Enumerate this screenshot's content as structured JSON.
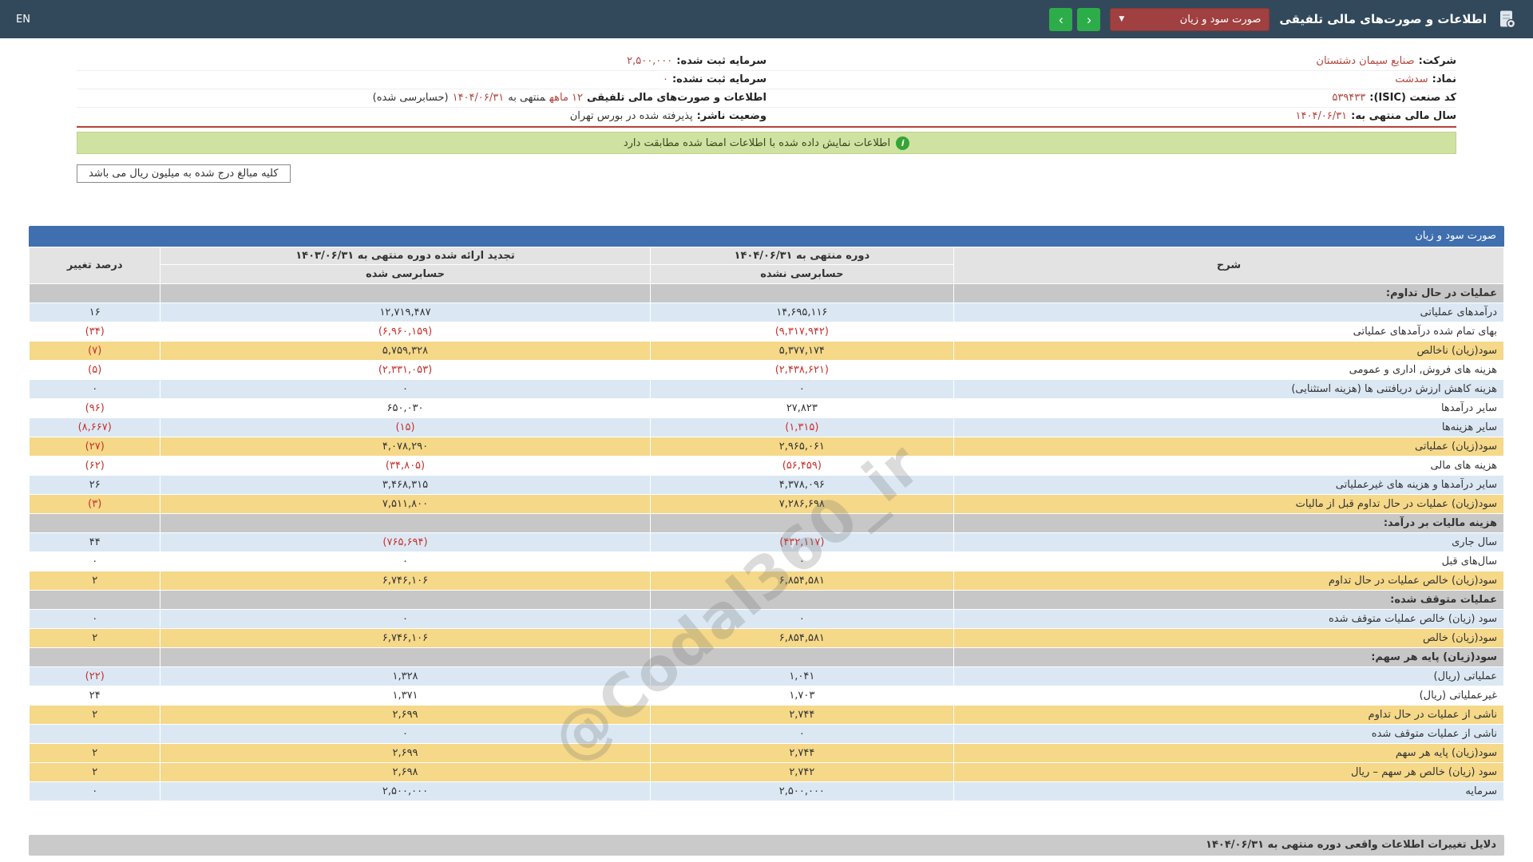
{
  "navbar": {
    "lang": "EN",
    "title": "اطلاعات و صورت‌های مالی تلفیقی",
    "dropdown": "صورت سود و زیان"
  },
  "icons": {
    "chevron_down": "▼",
    "prev": "‹",
    "next": "›",
    "info": "i"
  },
  "info": {
    "right": [
      {
        "parts": [
          {
            "t": "شرکت:",
            "s": "label"
          },
          {
            "t": "صنایع سیمان دشتستان",
            "s": "red"
          }
        ]
      },
      {
        "parts": [
          {
            "t": "نماد:",
            "s": "label"
          },
          {
            "t": "سدشت",
            "s": "red"
          }
        ]
      },
      {
        "parts": [
          {
            "t": "کد صنعت (ISIC):",
            "s": "label"
          },
          {
            "t": "۵۳۹۴۳۳",
            "s": "red"
          }
        ]
      },
      {
        "parts": [
          {
            "t": "سال مالی منتهی به:",
            "s": "label"
          },
          {
            "t": "۱۴۰۴/۰۶/۳۱",
            "s": "red"
          }
        ]
      }
    ],
    "left": [
      {
        "parts": [
          {
            "t": "سرمایه ثبت شده:",
            "s": "label"
          },
          {
            "t": "۲,۵۰۰,۰۰۰",
            "s": "red"
          }
        ]
      },
      {
        "parts": [
          {
            "t": "سرمایه ثبت نشده:",
            "s": "label"
          },
          {
            "t": "۰",
            "s": "red"
          }
        ]
      },
      {
        "parts": [
          {
            "t": "اطلاعات و صورت‌های مالی تلفیقی",
            "s": "label"
          },
          {
            "t": "۱۲ ماهه",
            "s": "red"
          },
          {
            "t": "منتهی به",
            "s": "plain"
          },
          {
            "t": "۱۴۰۴/۰۶/۳۱",
            "s": "red"
          },
          {
            "t": "(حسابرسی شده)",
            "s": "plain"
          }
        ]
      },
      {
        "parts": [
          {
            "t": "وضعیت ناشر:",
            "s": "label"
          },
          {
            "t": "پذیرفته شده در بورس تهران",
            "s": "plain"
          }
        ]
      }
    ]
  },
  "banner": {
    "text": "اطلاعات نمایش داده شده با اطلاعات امضا شده مطابقت دارد"
  },
  "note": {
    "text": "کلیه مبالغ درج شده به میلیون ریال می باشد"
  },
  "watermark": {
    "text": "@Codal360_ir"
  },
  "table": {
    "title": "صورت سود و زیان",
    "col_desc": "شرح",
    "col_current": "دوره منتهی به ۱۴۰۴/۰۶/۳۱",
    "col_current_sub": "حسابرسی نشده",
    "col_prior": "تجدید ارائه شده دوره منتهی به ۱۴۰۳/۰۶/۳۱",
    "col_prior_sub": "حسابرسی شده",
    "col_change": "درصد تغییر",
    "rows": [
      {
        "type": "section",
        "desc": "عملیات در حال تداوم:"
      },
      {
        "type": "blue",
        "desc": "درآمدهای عملیاتی",
        "v1": "۱۴,۶۹۵,۱۱۶",
        "v2": "۱۲,۷۱۹,۴۸۷",
        "pct": "۱۶"
      },
      {
        "type": "white",
        "desc": "بهای تمام شده درآمدهای عملیاتی",
        "v1": "(۹,۳۱۷,۹۴۲)",
        "v2": "(۶,۹۶۰,۱۵۹)",
        "pct": "(۳۴)"
      },
      {
        "type": "yellow",
        "desc": "سود(زیان) ناخالص",
        "v1": "۵,۳۷۷,۱۷۴",
        "v2": "۵,۷۵۹,۳۲۸",
        "pct": "(۷)"
      },
      {
        "type": "white",
        "desc": "هزینه های فروش, اداری و عمومی",
        "v1": "(۲,۴۳۸,۶۲۱)",
        "v2": "(۲,۳۳۱,۰۵۳)",
        "pct": "(۵)"
      },
      {
        "type": "blue",
        "desc": "هزینه کاهش ارزش دریافتنی ها (هزینه استثنایی)",
        "v1": "۰",
        "v2": "۰",
        "pct": "۰"
      },
      {
        "type": "white",
        "desc": "سایر درآمدها",
        "v1": "۲۷,۸۲۳",
        "v2": "۶۵۰,۰۳۰",
        "pct": "(۹۶)"
      },
      {
        "type": "blue",
        "desc": "سایر هزینه‌ها",
        "v1": "(۱,۳۱۵)",
        "v2": "(۱۵)",
        "pct": "(۸,۶۶۷)"
      },
      {
        "type": "yellow",
        "desc": "سود(زیان) عملیاتی",
        "v1": "۲,۹۶۵,۰۶۱",
        "v2": "۴,۰۷۸,۲۹۰",
        "pct": "(۲۷)"
      },
      {
        "type": "white",
        "desc": "هزینه های مالی",
        "v1": "(۵۶,۴۵۹)",
        "v2": "(۳۴,۸۰۵)",
        "pct": "(۶۲)"
      },
      {
        "type": "blue",
        "desc": "سایر درآمدها و هزینه های غیرعملیاتی",
        "v1": "۴,۳۷۸,۰۹۶",
        "v2": "۳,۴۶۸,۳۱۵",
        "pct": "۲۶"
      },
      {
        "type": "yellow",
        "desc": "سود(زیان) عملیات در حال تداوم قبل از مالیات",
        "v1": "۷,۲۸۶,۶۹۸",
        "v2": "۷,۵۱۱,۸۰۰",
        "pct": "(۳)"
      },
      {
        "type": "section",
        "desc": "هزینه مالیات بر درآمد:"
      },
      {
        "type": "blue",
        "desc": "سال جاری",
        "v1": "(۴۳۲,۱۱۷)",
        "v2": "(۷۶۵,۶۹۴)",
        "pct": "۴۴"
      },
      {
        "type": "white",
        "desc": "سال‌های قبل",
        "v1": "۰",
        "v2": "۰",
        "pct": "۰"
      },
      {
        "type": "yellow",
        "desc": "سود(زیان) خالص عملیات در حال تداوم",
        "v1": "۶,۸۵۴,۵۸۱",
        "v2": "۶,۷۴۶,۱۰۶",
        "pct": "۲"
      },
      {
        "type": "section",
        "desc": "عملیات متوقف شده:"
      },
      {
        "type": "blue",
        "desc": "سود (زیان) خالص عملیات متوقف شده",
        "v1": "۰",
        "v2": "۰",
        "pct": "۰"
      },
      {
        "type": "yellow",
        "desc": "سود(زیان) خالص",
        "v1": "۶,۸۵۴,۵۸۱",
        "v2": "۶,۷۴۶,۱۰۶",
        "pct": "۲"
      },
      {
        "type": "section",
        "desc": "سود(زیان) پایه هر سهم:"
      },
      {
        "type": "blue",
        "desc": "عملیاتی (ریال)",
        "v1": "۱,۰۴۱",
        "v2": "۱,۳۲۸",
        "pct": "(۲۲)"
      },
      {
        "type": "white",
        "desc": "غیرعملیاتی (ریال)",
        "v1": "۱,۷۰۳",
        "v2": "۱,۳۷۱",
        "pct": "۲۴"
      },
      {
        "type": "yellow",
        "desc": "ناشی از عملیات در حال تداوم",
        "v1": "۲,۷۴۴",
        "v2": "۲,۶۹۹",
        "pct": "۲"
      },
      {
        "type": "blue",
        "desc": "ناشی از عملیات متوقف شده",
        "v1": "۰",
        "v2": "۰",
        "pct": ""
      },
      {
        "type": "yellow",
        "desc": "سود(زیان) پایه هر سهم",
        "v1": "۲,۷۴۴",
        "v2": "۲,۶۹۹",
        "pct": "۲"
      },
      {
        "type": "yellow",
        "desc": "سود (زیان) خالص هر سهم – ریال",
        "v1": "۲,۷۴۲",
        "v2": "۲,۶۹۸",
        "pct": "۲"
      },
      {
        "type": "blue",
        "desc": "سرمایه",
        "v1": "۲,۵۰۰,۰۰۰",
        "v2": "۲,۵۰۰,۰۰۰",
        "pct": "۰"
      }
    ]
  },
  "footer": {
    "title": "دلایل تغییرات اطلاعات واقعی دوره منتهی به ۱۴۰۴/۰۶/۳۱"
  }
}
